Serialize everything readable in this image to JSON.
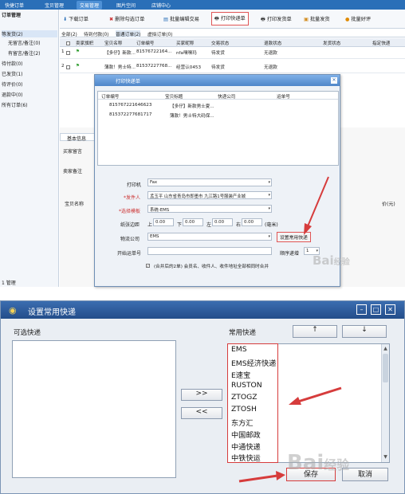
{
  "topnav": {
    "items": [
      "快捷订单",
      "宝贝管理",
      "交易管理",
      "图片空间",
      "店铺中心"
    ]
  },
  "sidebar": {
    "title": "订单管理",
    "items": [
      "等发货(2)",
      "无留言/备注(0)",
      "有留言/备注(2)",
      "待付款(0)",
      "已发货(1)",
      "待评价(0)",
      "退款中(0)",
      "所有订单(6)"
    ],
    "bottom": "1 管理"
  },
  "toolbar": {
    "items": [
      "下载订单",
      "删除勾选订单",
      "批量编辑交易",
      "打印快递单",
      "打印发货单",
      "批量发货",
      "批量好评"
    ]
  },
  "tabs": [
    "全部(2)",
    "待到付款(0)",
    "普通订单(2)",
    "虚拟订单(0)"
  ],
  "table": {
    "headers": [
      "卖家旗帜",
      "宝贝名称",
      "订单编号",
      "买家昵称",
      "交易状态",
      "退款状态",
      "发货状态",
      "指定快递"
    ],
    "rows": [
      {
        "num": "1",
        "name": "【多仔】新款...",
        "order": "81576722164...",
        "buyer": "nfa嘿嘿玛",
        "status": "待发货",
        "refund": "无退款"
      },
      {
        "num": "2",
        "name": "薄款！男士特...",
        "order": "81537227768...",
        "buyer": "经营认0453",
        "status": "待发货",
        "refund": "无退款"
      }
    ]
  },
  "lower": {
    "tab": "基本信息",
    "buyer_msg": "买家留言",
    "seller_note": "卖家备注",
    "col1": "宝贝名称",
    "col2": "价(元)"
  },
  "print_dialog": {
    "title": "打印快递单",
    "headers": [
      "订单编号",
      "宝贝标题",
      "快递公司",
      "运单号"
    ],
    "rows": [
      {
        "order": "815767221646623",
        "title": "【多仔】新款男士夏..."
      },
      {
        "order": "815372277681717",
        "title": "薄款！男士特大码保..."
      }
    ],
    "printer_label": "打印机",
    "printer_value": "Fax",
    "sender_label": "*发件人",
    "sender_value": "孟玉平 山东省青岛市即墨市 九江路1号服装产业城",
    "template_label": "*选择模板",
    "template_value": "系统-EMS",
    "margin_label": "纸张边距",
    "margins": {
      "top_label": "上",
      "top": "0.00",
      "bottom_label": "下",
      "bottom": "0.00",
      "left_label": "左",
      "left": "0.00",
      "right_label": "右",
      "right": "0.00",
      "unit": "(毫米)"
    },
    "courier_label": "物流公司",
    "courier_value": "EMS",
    "set_courier_btn": "设置常用快递",
    "start_no_label": "开始运单号",
    "order_label": "顺序递增",
    "order_value": "1",
    "merge_text": "(合并后的2单) 会员名、收件人、收件地址全部相同时合并"
  },
  "courier_dialog": {
    "title": "设置常用快递",
    "available_label": "可选快递",
    "common_label": "常用快递",
    "up_btn": "↑",
    "down_btn": "↓",
    "add_btn": ">>",
    "remove_btn": "<<",
    "couriers": [
      "EMS",
      "EMS经济快递",
      "E速宝",
      "RUSTON",
      "ZTOGZ",
      "ZTOSH",
      "东方汇",
      "中国邮政",
      "中通快递",
      "中铁快运"
    ],
    "save_btn": "保存",
    "cancel_btn": "取消"
  },
  "watermark": {
    "text": "Bai",
    "text2": "经验"
  },
  "colors": {
    "accent_red": "#d63c3c",
    "title_blue": "#2b5b9c"
  }
}
